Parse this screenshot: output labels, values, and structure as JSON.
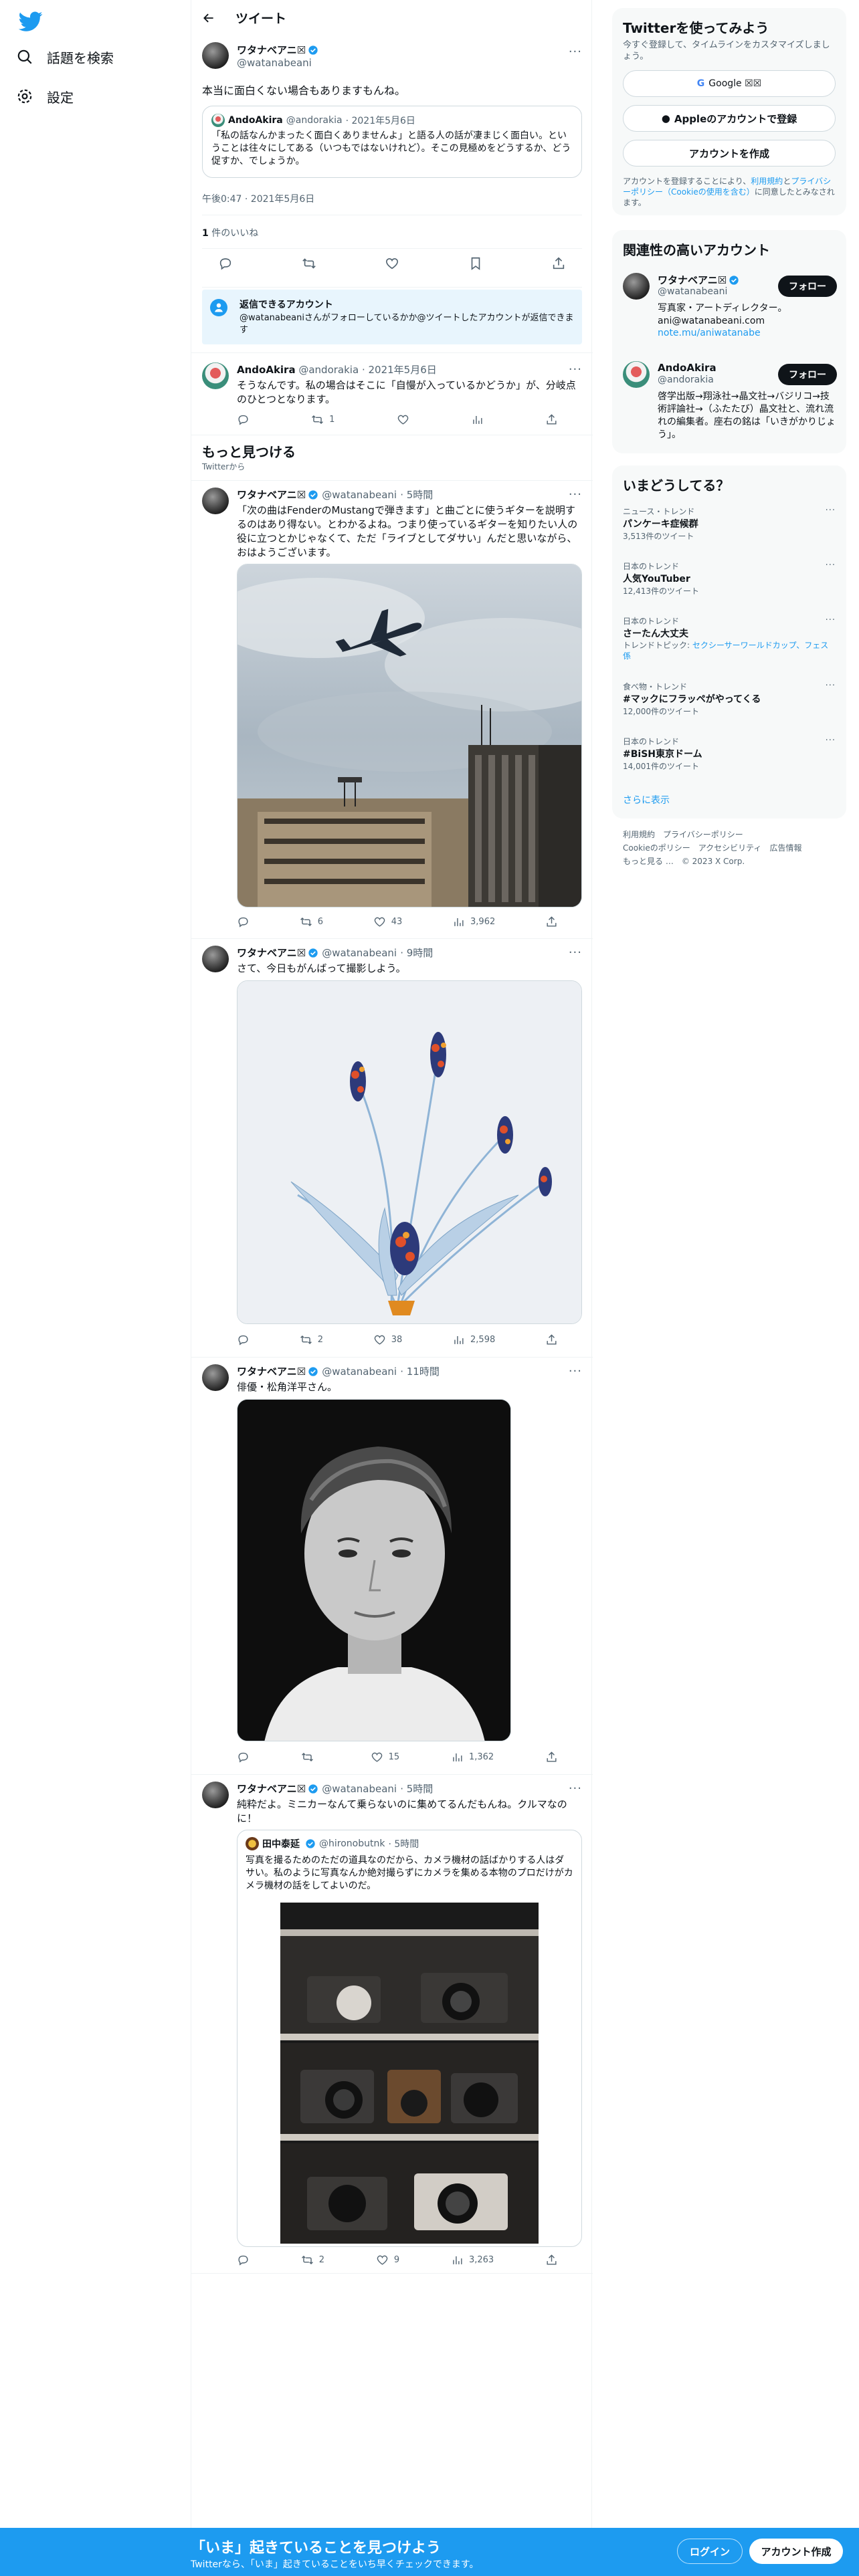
{
  "header": {
    "title": "ツイート"
  },
  "nav": {
    "explore": "話題を検索",
    "settings": "設定"
  },
  "main_tweet": {
    "name": "ワタナベアニ",
    "suffix": "☒",
    "handle": "@watanabeani",
    "text": "本当に面白くない場合もありますもんね。",
    "quote": {
      "name": "AndoAkira",
      "handle": "@andorakia",
      "date": "· 2021年5月6日",
      "text": "「私の話なんかまったく面白くありませんよ」と語る人の話が凄まじく面白い。ということは往々にしてある（いつもではないけれど）。そこの見極めをどうするか、どう促すか、でしょうか。"
    },
    "time": "午後0:47 · 2021年5月6日",
    "likes_count": "1",
    "likes_label": " 件のいいね"
  },
  "reply_notice": {
    "title": "返信できるアカウント",
    "text": "@watanabeaniさんがフォローしているかか@ツイートしたアカウントが返信できます"
  },
  "reply": {
    "name": "AndoAkira",
    "handle": "@andorakia",
    "date": "· 2021年5月6日",
    "text": "そうなんです。私の場合はそこに「自慢が入っているかどうか」が、分岐点のひとつとなります。",
    "retweets": "1"
  },
  "discover": {
    "title": "もっと見つける",
    "sub": "Twitterから"
  },
  "tweets": [
    {
      "name": "ワタナベアニ",
      "suffix": "☒",
      "handle": "@watanabeani",
      "time": "· 5時間",
      "text": "「次の曲はFenderのMustangで弾きます」と曲ごとに使うギターを説明するのはあり得ない。とわかるよね。つまり使っているギターを知りたい人の役に立つとかじゃなくて、ただ「ライブとしてダサい」んだと思いながら、 おはようございます。",
      "retweets": "6",
      "likes": "43",
      "views": "3,962"
    },
    {
      "name": "ワタナベアニ",
      "suffix": "☒",
      "handle": "@watanabeani",
      "time": "· 9時間",
      "text": "さて、今日もがんばって撮影しよう。",
      "retweets": "2",
      "likes": "38",
      "views": "2,598"
    },
    {
      "name": "ワタナベアニ",
      "suffix": "☒",
      "handle": "@watanabeani",
      "time": "· 11時間",
      "text": "俳優・松角洋平さん。",
      "retweets": "",
      "likes": "15",
      "views": "1,362"
    },
    {
      "name": "ワタナベアニ",
      "suffix": "☒",
      "handle": "@watanabeani",
      "time": "· 5時間",
      "text": "純粋だよ。ミニカーなんて乗らないのに集めてるんだもんね。クルマなのに！",
      "retweets": "2",
      "likes": "9",
      "views": "3,263",
      "quote": {
        "name": "田中泰延",
        "handle": "@hironobutnk",
        "time": "· 5時間",
        "text": "写真を撮るためのただの道具なのだから、カメラ機材の話ばかりする人はダサい。私のように写真なんか絶対撮らずにカメラを集める本物のプロだけがカメラ機材の話をしてよいのだ。"
      }
    }
  ],
  "signup": {
    "title": "Twitterを使ってみよう",
    "sub": "今すぐ登録して、タイムラインをカスタマイズしましょう。",
    "google": "Google ☒☒",
    "apple": "Appleのアカウントで登録",
    "create": "アカウントを作成",
    "terms_pre": "アカウントを登録することにより、",
    "terms_link1": "利用規約",
    "terms_mid": "と",
    "terms_link2": "プライバシーポリシー（Cookieの使用を含む）",
    "terms_post": "に同意したとみなされます。"
  },
  "related": {
    "title": "関連性の高いアカウント",
    "accounts": [
      {
        "name": "ワタナベアニ",
        "suffix": "☒",
        "handle": "@watanabeani",
        "bio": "写真家・アートディレクター。ani@watanabeani.com",
        "link": "note.mu/aniwatanabe",
        "follow": "フォロー"
      },
      {
        "name": "AndoAkira",
        "handle": "@andorakia",
        "bio": "啓学出版→翔泳社→晶文社→バジリコ→技術評論社→（ふたたび）晶文社と、流れ流れの編集者。座右の銘は「いきがかりじょう」。",
        "follow": "フォロー"
      }
    ]
  },
  "trends": {
    "title": "いまどうしてる？",
    "items": [
      {
        "meta": "ニュース・トレンド",
        "name": "パンケーキ症候群",
        "count": "3,513件のツイート"
      },
      {
        "meta": "日本のトレンド",
        "name": "人気YouTuber",
        "count": "12,413件のツイート"
      },
      {
        "meta": "日本のトレンド",
        "name": "さーたん大丈夫",
        "topic_pre": "トレンドトピック: ",
        "topic": "セクシーサーワールドカップ、フェス係"
      },
      {
        "meta": "食べ物・トレンド",
        "name": "#マックにフラッペがやってくる",
        "count": "12,000件のツイート"
      },
      {
        "meta": "日本のトレンド",
        "name": "#BiSH東京ドーム",
        "count": "14,001件のツイート"
      }
    ],
    "more": "さらに表示"
  },
  "footer": {
    "l1": "利用規約",
    "l2": "プライバシーポリシー",
    "l3": "Cookieのポリシー",
    "l4": "アクセシビリティ",
    "l5": "広告情報",
    "l6": "もっと見る …",
    "copy": "© 2023 X Corp."
  },
  "bottom": {
    "title": "「いま」起きていることを見つけよう",
    "sub": "Twitterなら、「いま」起きていることをいち早くチェックできます。",
    "login": "ログイン",
    "signup": "アカウント作成"
  },
  "colors": {
    "accent": "#1d9bf0",
    "text": "#0f1419",
    "muted": "#536471"
  }
}
